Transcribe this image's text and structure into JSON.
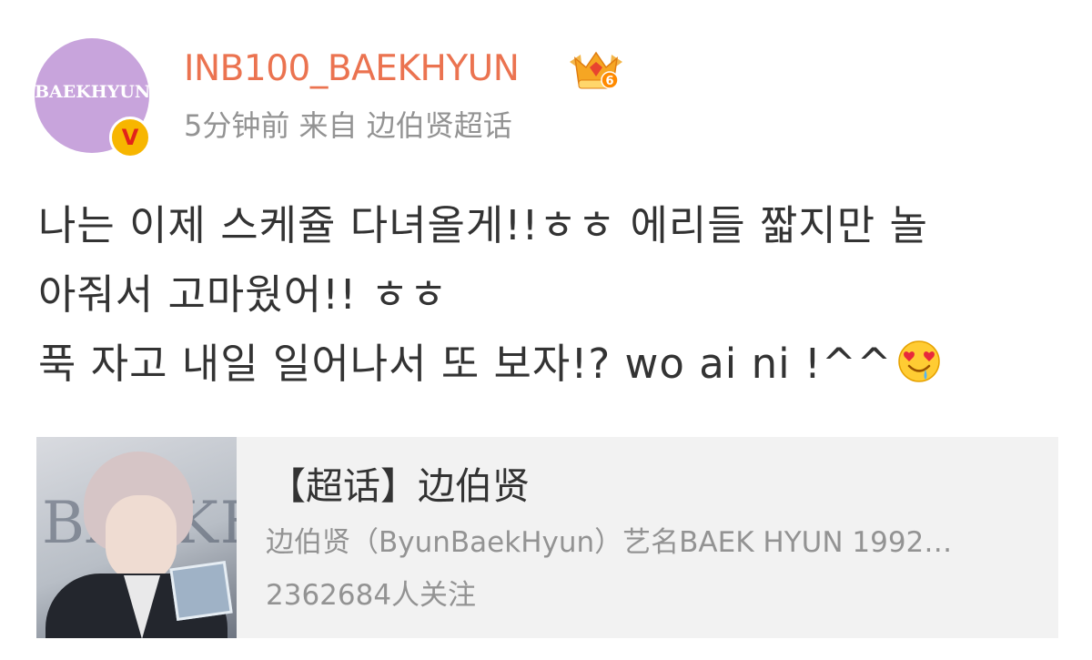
{
  "post": {
    "avatar": {
      "icon": "avatar-logo",
      "logo_text": "BAEKHYUN",
      "background": "#c8a4dc"
    },
    "verified_badge": {
      "icon": "verified-v-icon",
      "text": "V",
      "color": "#f7b600"
    },
    "username": "INB100_BAEKHYUN",
    "username_color": "#eb7350",
    "member_badge": {
      "icon": "crown-level-icon",
      "level": "6"
    },
    "meta": {
      "time": "5分钟前",
      "from_label": "来自",
      "source": "边伯贤超话"
    },
    "content_lines": [
      "나는 이제 스케쥴 다녀올게!!ㅎㅎ 에리들 짧지만 놀",
      "아줘서 고마웠어!! ㅎㅎ",
      "푹 자고 내일 일어나서 또 보자!? wo ai ni !^^"
    ],
    "content_emoji": "heart-eyes-drooling-emoji",
    "card": {
      "thumbnail": "baekhyun-photo",
      "thumbnail_text": "BAEKHYUN",
      "title": "【超话】边伯贤",
      "description": "边伯贤（ByunBaekHyun）艺名BAEK HYUN 1992…",
      "followers": "2362684人关注"
    }
  }
}
